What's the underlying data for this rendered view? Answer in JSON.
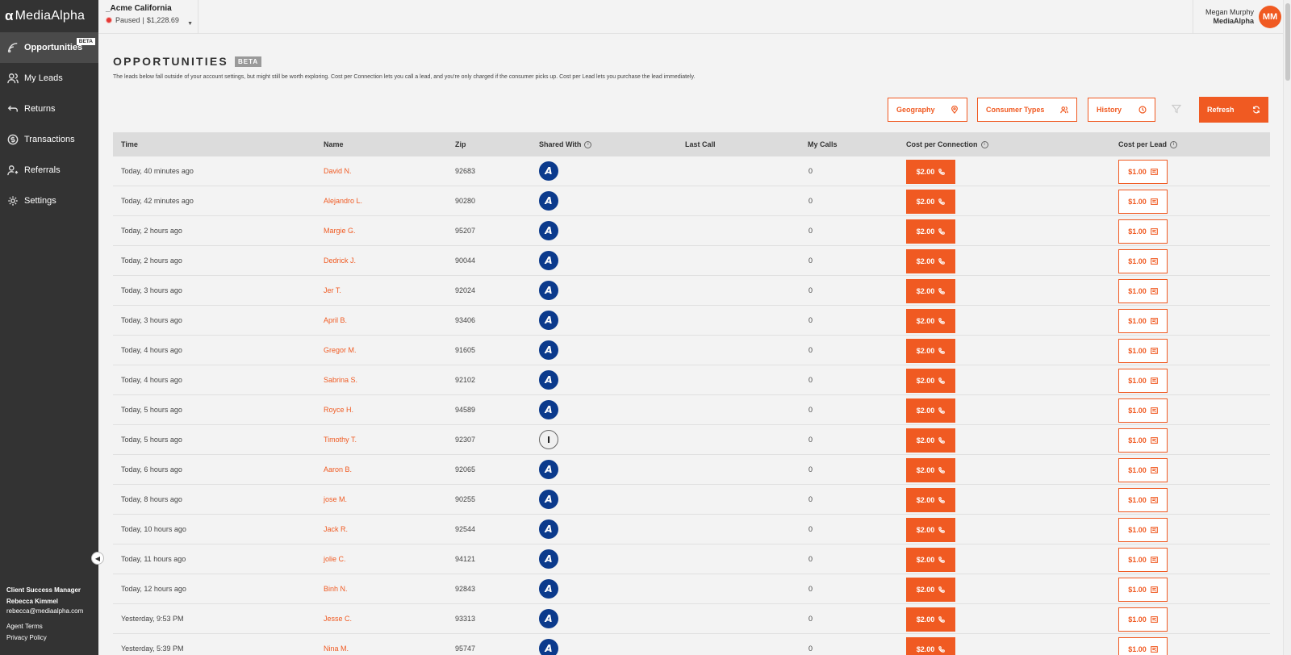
{
  "brand": {
    "name": "MediaAlpha",
    "accent": "#f05a22",
    "sidebar_bg": "#333333"
  },
  "sidebar": {
    "items": [
      {
        "label": "Opportunities",
        "icon": "signal-icon",
        "badge": "BETA",
        "active": true
      },
      {
        "label": "My Leads",
        "icon": "people-icon"
      },
      {
        "label": "Returns",
        "icon": "return-arrow-icon"
      },
      {
        "label": "Transactions",
        "icon": "dollar-icon"
      },
      {
        "label": "Referrals",
        "icon": "referral-icon"
      },
      {
        "label": "Settings",
        "icon": "gear-icon"
      }
    ],
    "csm": {
      "title": "Client Success Manager",
      "name": "Rebecca Kimmel",
      "email": "rebecca@mediaalpha.com"
    },
    "links": [
      "Agent Terms",
      "Privacy Policy"
    ]
  },
  "account": {
    "name": "_Acme California",
    "status": "Paused",
    "balance": "$1,228.69"
  },
  "user": {
    "name": "Megan Murphy",
    "company": "MediaAlpha",
    "initials": "MM"
  },
  "page": {
    "title": "OPPORTUNITIES",
    "badge": "BETA",
    "description": "The leads below fall outside of your account settings, but might still be worth exploring. Cost per Connection lets you call a lead, and you're only charged if the consumer picks up. Cost per Lead lets you purchase the lead immediately."
  },
  "filters": {
    "geography": "Geography",
    "consumer_types": "Consumer Types",
    "history": "History",
    "refresh": "Refresh"
  },
  "table": {
    "columns": {
      "time": "Time",
      "name": "Name",
      "zip": "Zip",
      "shared_with": "Shared With",
      "last_call": "Last Call",
      "my_calls": "My Calls",
      "cost_per_connection": "Cost per Connection",
      "cost_per_lead": "Cost per Lead"
    },
    "rows": [
      {
        "time": "Today, 40 minutes ago",
        "name": "David N.",
        "zip": "92683",
        "shared": "A",
        "calls": "0",
        "cpc": "$2.00",
        "cpl": "$1.00"
      },
      {
        "time": "Today, 42 minutes ago",
        "name": "Alejandro L.",
        "zip": "90280",
        "shared": "A",
        "calls": "0",
        "cpc": "$2.00",
        "cpl": "$1.00"
      },
      {
        "time": "Today, 2 hours ago",
        "name": "Margie G.",
        "zip": "95207",
        "shared": "A",
        "calls": "0",
        "cpc": "$2.00",
        "cpl": "$1.00"
      },
      {
        "time": "Today, 2 hours ago",
        "name": "Dedrick J.",
        "zip": "90044",
        "shared": "A",
        "calls": "0",
        "cpc": "$2.00",
        "cpl": "$1.00"
      },
      {
        "time": "Today, 3 hours ago",
        "name": "Jer T.",
        "zip": "92024",
        "shared": "A",
        "calls": "0",
        "cpc": "$2.00",
        "cpl": "$1.00"
      },
      {
        "time": "Today, 3 hours ago",
        "name": "April B.",
        "zip": "93406",
        "shared": "A",
        "calls": "0",
        "cpc": "$2.00",
        "cpl": "$1.00"
      },
      {
        "time": "Today, 4 hours ago",
        "name": "Gregor M.",
        "zip": "91605",
        "shared": "A",
        "calls": "0",
        "cpc": "$2.00",
        "cpl": "$1.00"
      },
      {
        "time": "Today, 4 hours ago",
        "name": "Sabrina S.",
        "zip": "92102",
        "shared": "A",
        "calls": "0",
        "cpc": "$2.00",
        "cpl": "$1.00"
      },
      {
        "time": "Today, 5 hours ago",
        "name": "Royce H.",
        "zip": "94589",
        "shared": "A",
        "calls": "0",
        "cpc": "$2.00",
        "cpl": "$1.00"
      },
      {
        "time": "Today, 5 hours ago",
        "name": "Timothy T.",
        "zip": "92307",
        "shared": "I",
        "calls": "0",
        "cpc": "$2.00",
        "cpl": "$1.00"
      },
      {
        "time": "Today, 6 hours ago",
        "name": "Aaron B.",
        "zip": "92065",
        "shared": "A",
        "calls": "0",
        "cpc": "$2.00",
        "cpl": "$1.00"
      },
      {
        "time": "Today, 8 hours ago",
        "name": "jose M.",
        "zip": "90255",
        "shared": "A",
        "calls": "0",
        "cpc": "$2.00",
        "cpl": "$1.00"
      },
      {
        "time": "Today, 10 hours ago",
        "name": "Jack R.",
        "zip": "92544",
        "shared": "A",
        "calls": "0",
        "cpc": "$2.00",
        "cpl": "$1.00"
      },
      {
        "time": "Today, 11 hours ago",
        "name": "jolie C.",
        "zip": "94121",
        "shared": "A",
        "calls": "0",
        "cpc": "$2.00",
        "cpl": "$1.00"
      },
      {
        "time": "Today, 12 hours ago",
        "name": "Binh N.",
        "zip": "92843",
        "shared": "A",
        "calls": "0",
        "cpc": "$2.00",
        "cpl": "$1.00"
      },
      {
        "time": "Yesterday, 9:53 PM",
        "name": "Jesse C.",
        "zip": "93313",
        "shared": "A",
        "calls": "0",
        "cpc": "$2.00",
        "cpl": "$1.00"
      },
      {
        "time": "Yesterday, 5:39 PM",
        "name": "Nina M.",
        "zip": "95747",
        "shared": "A",
        "calls": "0",
        "cpc": "$2.00",
        "cpl": "$1.00"
      }
    ]
  }
}
